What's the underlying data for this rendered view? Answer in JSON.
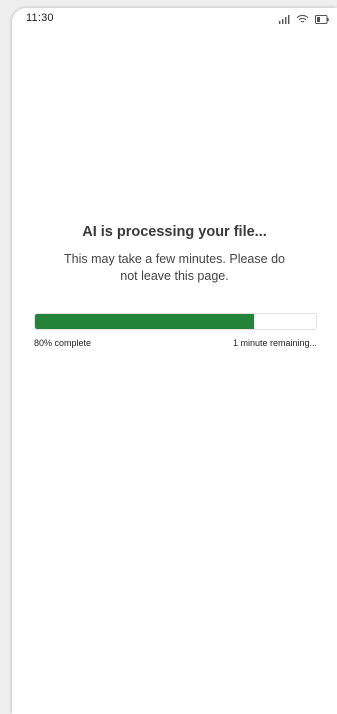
{
  "status_bar": {
    "time": "11:30",
    "icons": [
      "signal-icon",
      "wifi-icon",
      "battery-icon"
    ]
  },
  "processing": {
    "title": "AI is processing your file...",
    "subtitle": "This may take a few minutes. Please do not leave this page.",
    "progress_fraction": 0.78,
    "progress_percent_label": "80% complete",
    "time_remaining": "1 minute remaining..."
  },
  "colors": {
    "progress_fill": "#238339",
    "progress_track_border": "#e1e1e1",
    "background": "#ffffff"
  }
}
